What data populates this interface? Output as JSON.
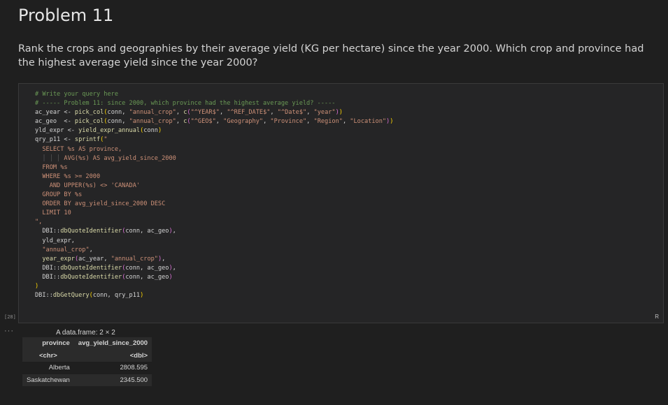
{
  "markdown": {
    "title": "Problem 11",
    "question": "Rank the crops and geographies by their average yield (KG per hectare) since the year 2000. Which crop and province had the highest average yield since the year 2000?"
  },
  "code_cell": {
    "execution_count": "[28]",
    "language": "R",
    "lines": [
      [
        {
          "t": "# Write your query here",
          "c": "cmt"
        }
      ],
      [
        {
          "t": "# ----- Problem 11: since 2000, which province had the highest average yield? -----",
          "c": "cmt"
        }
      ],
      [
        {
          "t": "ac_year <- "
        },
        {
          "t": "pick_col",
          "c": "fn"
        },
        {
          "t": "(",
          "c": "pr"
        },
        {
          "t": "conn, "
        },
        {
          "t": "\"annual_crop\"",
          "c": "str"
        },
        {
          "t": ", "
        },
        {
          "t": "c",
          "c": "fn"
        },
        {
          "t": "(",
          "c": "pp"
        },
        {
          "t": "\"^YEAR$\"",
          "c": "str"
        },
        {
          "t": ", "
        },
        {
          "t": "\"^REF_DATE$\"",
          "c": "str"
        },
        {
          "t": ", "
        },
        {
          "t": "\"^Date$\"",
          "c": "str"
        },
        {
          "t": ", "
        },
        {
          "t": "\"year\"",
          "c": "str"
        },
        {
          "t": ")",
          "c": "pp"
        },
        {
          "t": ")",
          "c": "pr"
        }
      ],
      [
        {
          "t": "ac_geo  <- "
        },
        {
          "t": "pick_col",
          "c": "fn"
        },
        {
          "t": "(",
          "c": "pr"
        },
        {
          "t": "conn, "
        },
        {
          "t": "\"annual_crop\"",
          "c": "str"
        },
        {
          "t": ", "
        },
        {
          "t": "c",
          "c": "fn"
        },
        {
          "t": "(",
          "c": "pp"
        },
        {
          "t": "\"^GEO$\"",
          "c": "str"
        },
        {
          "t": ", "
        },
        {
          "t": "\"Geography\"",
          "c": "str"
        },
        {
          "t": ", "
        },
        {
          "t": "\"Province\"",
          "c": "str"
        },
        {
          "t": ", "
        },
        {
          "t": "\"Region\"",
          "c": "str"
        },
        {
          "t": ", "
        },
        {
          "t": "\"Location\"",
          "c": "str"
        },
        {
          "t": ")",
          "c": "pp"
        },
        {
          "t": ")",
          "c": "pr"
        }
      ],
      [
        {
          "t": "yld_expr <- "
        },
        {
          "t": "yield_expr_annual",
          "c": "fn"
        },
        {
          "t": "(",
          "c": "pr"
        },
        {
          "t": "conn"
        },
        {
          "t": ")",
          "c": "pr"
        }
      ],
      [
        {
          "t": "qry_p11 <- "
        },
        {
          "t": "sprintf",
          "c": "fn"
        },
        {
          "t": "(",
          "c": "pr"
        },
        {
          "t": "\"",
          "c": "str"
        }
      ],
      [
        {
          "t": "  SELECT %s AS province,",
          "c": "str"
        }
      ],
      [
        {
          "t": "  ",
          "c": "str"
        },
        {
          "t": "│ │ │ ",
          "c": "guide"
        },
        {
          "t": "AVG(%s) AS avg_yield_since_2000",
          "c": "str"
        }
      ],
      [
        {
          "t": "  FROM %s",
          "c": "str"
        }
      ],
      [
        {
          "t": "  WHERE %s >= 2000",
          "c": "str"
        }
      ],
      [
        {
          "t": "    AND UPPER(%s) <> 'CANADA'",
          "c": "str"
        }
      ],
      [
        {
          "t": "  GROUP BY %s",
          "c": "str"
        }
      ],
      [
        {
          "t": "  ORDER BY avg_yield_since_2000 DESC",
          "c": "str"
        }
      ],
      [
        {
          "t": "  LIMIT 10",
          "c": "str"
        }
      ],
      [
        {
          "t": "\",",
          "c": "str"
        }
      ],
      [
        {
          "t": "  DBI::"
        },
        {
          "t": "dbQuoteIdentifier",
          "c": "fn"
        },
        {
          "t": "(",
          "c": "pp"
        },
        {
          "t": "conn, ac_geo"
        },
        {
          "t": ")",
          "c": "pp"
        },
        {
          "t": ","
        }
      ],
      [
        {
          "t": "  yld_expr,"
        }
      ],
      [
        {
          "t": "  "
        },
        {
          "t": "\"annual_crop\"",
          "c": "str"
        },
        {
          "t": ","
        }
      ],
      [
        {
          "t": "  "
        },
        {
          "t": "year_expr",
          "c": "fn"
        },
        {
          "t": "(",
          "c": "pp"
        },
        {
          "t": "ac_year, "
        },
        {
          "t": "\"annual_crop\"",
          "c": "str"
        },
        {
          "t": ")",
          "c": "pp"
        },
        {
          "t": ","
        }
      ],
      [
        {
          "t": "  DBI::"
        },
        {
          "t": "dbQuoteIdentifier",
          "c": "fn"
        },
        {
          "t": "(",
          "c": "pp"
        },
        {
          "t": "conn, ac_geo"
        },
        {
          "t": ")",
          "c": "pp"
        },
        {
          "t": ","
        }
      ],
      [
        {
          "t": "  DBI::"
        },
        {
          "t": "dbQuoteIdentifier",
          "c": "fn"
        },
        {
          "t": "(",
          "c": "pp"
        },
        {
          "t": "conn, ac_geo"
        },
        {
          "t": ")",
          "c": "pp"
        }
      ],
      [
        {
          "t": ")",
          "c": "pr"
        }
      ],
      [
        {
          "t": "DBI::"
        },
        {
          "t": "dbGetQuery",
          "c": "fn"
        },
        {
          "t": "(",
          "c": "pr"
        },
        {
          "t": "conn, qry_p11"
        },
        {
          "t": ")",
          "c": "pr"
        }
      ]
    ]
  },
  "output": {
    "dots": "···",
    "caption": "A data.frame: 2 × 2",
    "headers": [
      "province",
      "avg_yield_since_2000"
    ],
    "types": [
      "<chr>",
      "<dbl>"
    ],
    "rows": [
      [
        "Alberta",
        "2808.595"
      ],
      [
        "Saskatchewan",
        "2345.500"
      ]
    ]
  }
}
